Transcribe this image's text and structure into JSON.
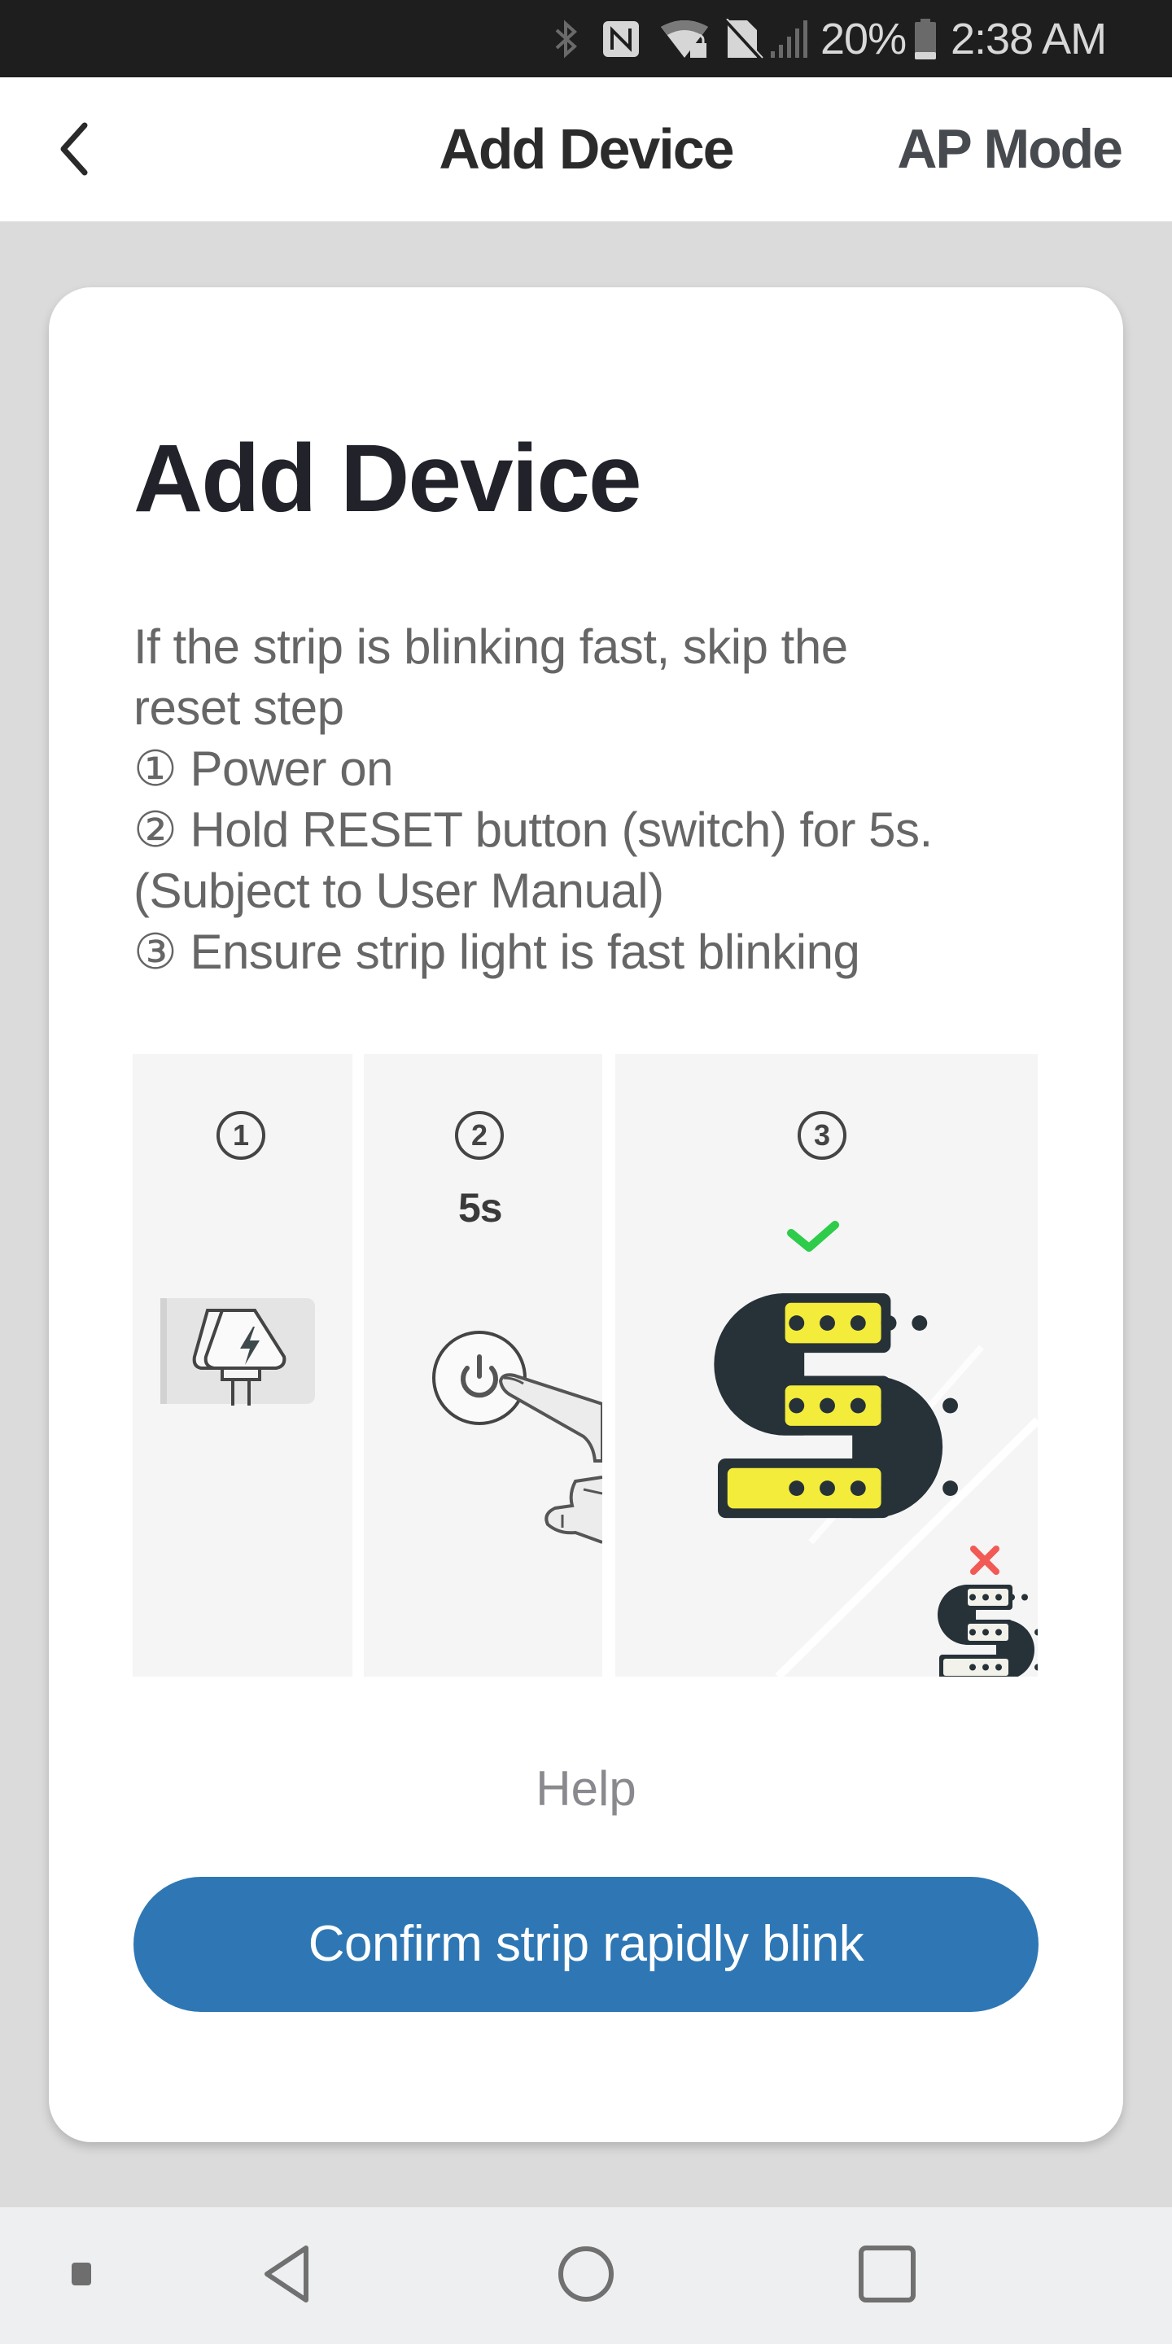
{
  "status_bar": {
    "icons": [
      "bluetooth-icon",
      "nfc-icon",
      "wifi-locked-icon",
      "no-sim-icon",
      "signal-icon"
    ],
    "battery_percent": "20%",
    "battery_level": 0.2,
    "time": "2:38 AM"
  },
  "header": {
    "back_icon": "chevron-left-icon",
    "title": "Add Device",
    "right_action": "AP Mode"
  },
  "card": {
    "title": "Add Device",
    "description_lines": [
      "If the strip is blinking fast, skip the",
      "reset step",
      "①  Power on",
      "②  Hold RESET button (switch) for 5s.",
      "(Subject to User Manual)",
      "③  Ensure strip light is fast blinking"
    ],
    "illustration": {
      "panels": [
        {
          "step": "1",
          "icon": "power-plug-icon"
        },
        {
          "step": "2",
          "label": "5s",
          "icon": "power-button-press-icon"
        },
        {
          "step": "3",
          "icon": "led-strip-icon",
          "correct_icon": "checkmark-icon",
          "incorrect_icon": "cross-icon"
        }
      ],
      "colors": {
        "strip_yellow": "#f4ec3a",
        "strip_outline": "#263238",
        "check_green": "#2ecc4a",
        "cross_red": "#f25a55"
      }
    },
    "help_label": "Help",
    "confirm_button": "Confirm strip rapidly blink",
    "accent_color": "#2e77b4"
  },
  "nav_bar": {
    "buttons": [
      "menu-dot-icon",
      "back-triangle-icon",
      "home-circle-icon",
      "recents-square-icon"
    ]
  }
}
